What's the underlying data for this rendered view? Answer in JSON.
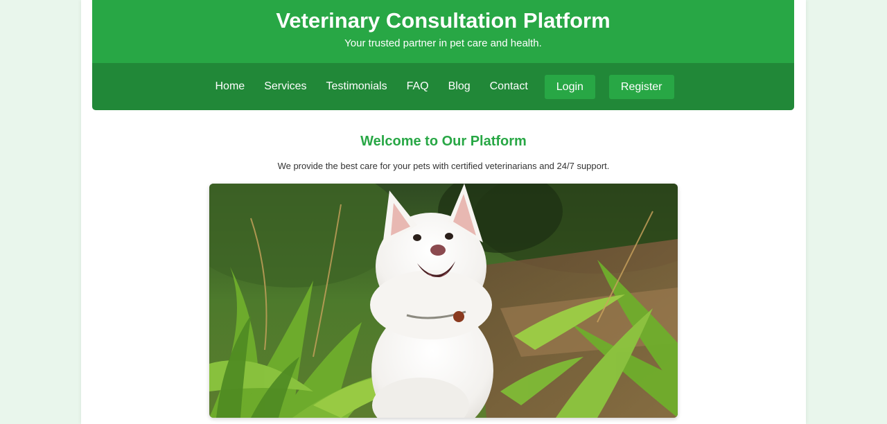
{
  "header": {
    "title": "Veterinary Consultation Platform",
    "tagline": "Your trusted partner in pet care and health."
  },
  "nav": {
    "links": [
      {
        "label": "Home"
      },
      {
        "label": "Services"
      },
      {
        "label": "Testimonials"
      },
      {
        "label": "FAQ"
      },
      {
        "label": "Blog"
      },
      {
        "label": "Contact"
      }
    ],
    "login_label": "Login",
    "register_label": "Register"
  },
  "welcome": {
    "title": "Welcome to Our Platform",
    "text": "We provide the best care for your pets with certified veterinarians and 24/7 support."
  },
  "hero_image": {
    "icon": "dog-photo"
  },
  "colors": {
    "primary": "#28a745",
    "primary_dark": "#218838",
    "background": "#e9f6ec"
  }
}
